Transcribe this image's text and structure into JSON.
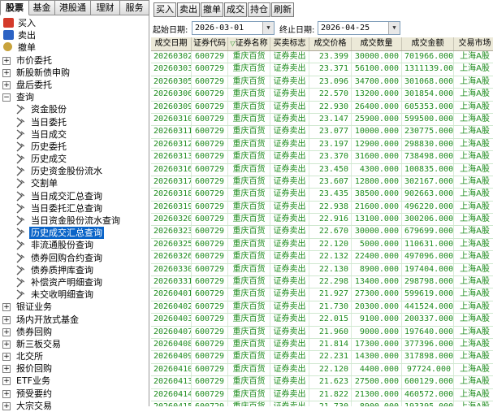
{
  "tabs": [
    "股票",
    "基金",
    "港股通",
    "理财",
    "服务"
  ],
  "active_tab": 0,
  "tree": [
    {
      "label": "买入",
      "icon": "buy-icon"
    },
    {
      "label": "卖出",
      "icon": "sell-icon"
    },
    {
      "label": "撤单",
      "icon": "stop-icon"
    },
    {
      "label": "市价委托",
      "expander": "+"
    },
    {
      "label": "新股新债申购",
      "expander": "+"
    },
    {
      "label": "盘后委托",
      "expander": "+"
    },
    {
      "label": "查询",
      "expander": "-"
    },
    {
      "label": "资金股份",
      "leaf": true
    },
    {
      "label": "当日委托",
      "leaf": true
    },
    {
      "label": "当日成交",
      "leaf": true
    },
    {
      "label": "历史委托",
      "leaf": true
    },
    {
      "label": "历史成交",
      "leaf": true
    },
    {
      "label": "历史资金股份流水",
      "leaf": true
    },
    {
      "label": "交割单",
      "leaf": true
    },
    {
      "label": "当日成交汇总查询",
      "leaf": true
    },
    {
      "label": "当日委托汇总查询",
      "leaf": true
    },
    {
      "label": "当日资金股份流水查询",
      "leaf": true
    },
    {
      "label": "历史成交汇总查询",
      "leaf": true,
      "selected": true
    },
    {
      "label": "非流通股份查询",
      "leaf": true
    },
    {
      "label": "债券回购合约查询",
      "leaf": true
    },
    {
      "label": "债券质押库查询",
      "leaf": true
    },
    {
      "label": "补偿资产明细查询",
      "leaf": true
    },
    {
      "label": "未交收明细查询",
      "leaf": true
    },
    {
      "label": "银证业务",
      "expander": "+"
    },
    {
      "label": "场内开放式基金",
      "expander": "+"
    },
    {
      "label": "债券回购",
      "expander": "+"
    },
    {
      "label": "新三板交易",
      "expander": "+"
    },
    {
      "label": "北交所",
      "expander": "+"
    },
    {
      "label": "报价回购",
      "expander": "+"
    },
    {
      "label": "ETF业务",
      "expander": "+"
    },
    {
      "label": "预受要约",
      "expander": "+"
    },
    {
      "label": "大宗交易",
      "expander": "+"
    }
  ],
  "toolbar": [
    "买入",
    "卖出",
    "撤单",
    "成交",
    "持仓",
    "刷新"
  ],
  "filters": {
    "start_label": "起始日期:",
    "start_value": "2026-03-01",
    "end_label": "终止日期:",
    "end_value": "2026-04-25"
  },
  "columns": [
    "成交日期",
    "证券代码",
    "证券名称",
    "买卖标志",
    "成交价格",
    "成交数量",
    "成交金额",
    "交易市场"
  ],
  "sort_column": 2,
  "rows": [
    [
      "20260302",
      "600729",
      "重庆百货",
      "证券卖出",
      "23.399",
      "30000.000",
      "701966.000",
      "上海A股"
    ],
    [
      "20260303",
      "600729",
      "重庆百货",
      "证券卖出",
      "23.371",
      "56100.000",
      "1311139.000",
      "上海A股"
    ],
    [
      "20260305",
      "600729",
      "重庆百货",
      "证券卖出",
      "23.096",
      "34700.000",
      "301068.000",
      "上海A股"
    ],
    [
      "20260306",
      "600729",
      "重庆百货",
      "证券卖出",
      "22.570",
      "13200.000",
      "301854.000",
      "上海A股"
    ],
    [
      "20260309",
      "600729",
      "重庆百货",
      "证券卖出",
      "22.930",
      "26400.000",
      "605353.000",
      "上海A股"
    ],
    [
      "20260310",
      "600729",
      "重庆百货",
      "证券卖出",
      "23.147",
      "25900.000",
      "599500.000",
      "上海A股"
    ],
    [
      "20260311",
      "600729",
      "重庆百货",
      "证券卖出",
      "23.077",
      "10000.000",
      "230775.000",
      "上海A股"
    ],
    [
      "20260312",
      "600729",
      "重庆百货",
      "证券卖出",
      "23.197",
      "12900.000",
      "298830.000",
      "上海A股"
    ],
    [
      "20260313",
      "600729",
      "重庆百货",
      "证券卖出",
      "23.370",
      "31600.000",
      "738498.000",
      "上海A股"
    ],
    [
      "20260316",
      "600729",
      "重庆百货",
      "证券卖出",
      "23.450",
      "4300.000",
      "100835.000",
      "上海A股"
    ],
    [
      "20260317",
      "600729",
      "重庆百货",
      "证券卖出",
      "23.607",
      "12800.000",
      "302167.000",
      "上海A股"
    ],
    [
      "20260318",
      "600729",
      "重庆百货",
      "证券卖出",
      "23.435",
      "38500.000",
      "902663.000",
      "上海A股"
    ],
    [
      "20260319",
      "600729",
      "重庆百货",
      "证券卖出",
      "22.938",
      "21600.000",
      "496220.000",
      "上海A股"
    ],
    [
      "20260320",
      "600729",
      "重庆百货",
      "证券卖出",
      "22.916",
      "13100.000",
      "300206.000",
      "上海A股"
    ],
    [
      "20260323",
      "600729",
      "重庆百货",
      "证券卖出",
      "22.670",
      "30000.000",
      "679699.000",
      "上海A股"
    ],
    [
      "20260325",
      "600729",
      "重庆百货",
      "证券卖出",
      "22.120",
      "5000.000",
      "110631.000",
      "上海A股"
    ],
    [
      "20260326",
      "600729",
      "重庆百货",
      "证券卖出",
      "22.132",
      "22400.000",
      "497096.000",
      "上海A股"
    ],
    [
      "20260330",
      "600729",
      "重庆百货",
      "证券卖出",
      "22.130",
      "8900.000",
      "197404.000",
      "上海A股"
    ],
    [
      "20260331",
      "600729",
      "重庆百货",
      "证券卖出",
      "22.298",
      "13400.000",
      "298798.000",
      "上海A股"
    ],
    [
      "20260401",
      "600729",
      "重庆百货",
      "证券卖出",
      "21.927",
      "27300.000",
      "599619.000",
      "上海A股"
    ],
    [
      "20260402",
      "600729",
      "重庆百货",
      "证券卖出",
      "21.730",
      "20300.000",
      "441524.000",
      "上海A股"
    ],
    [
      "20260403",
      "600729",
      "重庆百货",
      "证券卖出",
      "22.015",
      "9100.000",
      "200337.000",
      "上海A股"
    ],
    [
      "20260407",
      "600729",
      "重庆百货",
      "证券卖出",
      "21.960",
      "9000.000",
      "197640.000",
      "上海A股"
    ],
    [
      "20260408",
      "600729",
      "重庆百货",
      "证券卖出",
      "21.814",
      "17300.000",
      "377396.000",
      "上海A股"
    ],
    [
      "20260409",
      "600729",
      "重庆百货",
      "证券卖出",
      "22.231",
      "14300.000",
      "317898.000",
      "上海A股"
    ],
    [
      "20260410",
      "600729",
      "重庆百货",
      "证券卖出",
      "22.120",
      "4400.000",
      "97724.000",
      "上海A股"
    ],
    [
      "20260413",
      "600729",
      "重庆百货",
      "证券卖出",
      "21.623",
      "27500.000",
      "600129.000",
      "上海A股"
    ],
    [
      "20260414",
      "600729",
      "重庆百货",
      "证券卖出",
      "21.822",
      "21300.000",
      "460572.000",
      "上海A股"
    ],
    [
      "20260415",
      "600729",
      "重庆百货",
      "证券卖出",
      "21.730",
      "8900.000",
      "193395.000",
      "上海A股"
    ],
    [
      "20260416",
      "600729",
      "重庆百货",
      "证券卖出",
      "21.709",
      "8900.000",
      "193213.000",
      "上海A股"
    ]
  ],
  "chart_data": {
    "type": "table",
    "title": "",
    "columns": [
      "成交日期",
      "证券代码",
      "证券名称",
      "买卖标志",
      "成交价格",
      "成交数量",
      "成交金额",
      "交易市场"
    ],
    "rows": [
      [
        "20260302",
        "600729",
        "重庆百货",
        "证券卖出",
        23.399,
        30000,
        701966,
        "上海A股"
      ],
      [
        "20260303",
        "600729",
        "重庆百货",
        "证券卖出",
        23.371,
        56100,
        1311139,
        "上海A股"
      ],
      [
        "20260305",
        "600729",
        "重庆百货",
        "证券卖出",
        23.096,
        34700,
        301068,
        "上海A股"
      ],
      [
        "20260306",
        "600729",
        "重庆百货",
        "证券卖出",
        22.57,
        13200,
        301854,
        "上海A股"
      ],
      [
        "20260309",
        "600729",
        "重庆百货",
        "证券卖出",
        22.93,
        26400,
        605353,
        "上海A股"
      ],
      [
        "20260310",
        "600729",
        "重庆百货",
        "证券卖出",
        23.147,
        25900,
        599500,
        "上海A股"
      ],
      [
        "20260311",
        "600729",
        "重庆百货",
        "证券卖出",
        23.077,
        10000,
        230775,
        "上海A股"
      ],
      [
        "20260312",
        "600729",
        "重庆百货",
        "证券卖出",
        23.197,
        12900,
        298830,
        "上海A股"
      ],
      [
        "20260313",
        "600729",
        "重庆百货",
        "证券卖出",
        23.37,
        31600,
        738498,
        "上海A股"
      ],
      [
        "20260316",
        "600729",
        "重庆百货",
        "证券卖出",
        23.45,
        4300,
        100835,
        "上海A股"
      ],
      [
        "20260317",
        "600729",
        "重庆百货",
        "证券卖出",
        23.607,
        12800,
        302167,
        "上海A股"
      ],
      [
        "20260318",
        "600729",
        "重庆百货",
        "证券卖出",
        23.435,
        38500,
        902663,
        "上海A股"
      ],
      [
        "20260319",
        "600729",
        "重庆百货",
        "证券卖出",
        22.938,
        21600,
        496220,
        "上海A股"
      ],
      [
        "20260320",
        "600729",
        "重庆百货",
        "证券卖出",
        22.916,
        13100,
        300206,
        "上海A股"
      ],
      [
        "20260323",
        "600729",
        "重庆百货",
        "证券卖出",
        22.67,
        30000,
        679699,
        "上海A股"
      ],
      [
        "20260325",
        "600729",
        "重庆百货",
        "证券卖出",
        22.12,
        5000,
        110631,
        "上海A股"
      ],
      [
        "20260326",
        "600729",
        "重庆百货",
        "证券卖出",
        22.132,
        22400,
        497096,
        "上海A股"
      ],
      [
        "20260330",
        "600729",
        "重庆百货",
        "证券卖出",
        22.13,
        8900,
        197404,
        "上海A股"
      ],
      [
        "20260331",
        "600729",
        "重庆百货",
        "证券卖出",
        22.298,
        13400,
        298798,
        "上海A股"
      ],
      [
        "20260401",
        "600729",
        "重庆百货",
        "证券卖出",
        21.927,
        27300,
        599619,
        "上海A股"
      ],
      [
        "20260402",
        "600729",
        "重庆百货",
        "证券卖出",
        21.73,
        20300,
        441524,
        "上海A股"
      ],
      [
        "20260403",
        "600729",
        "重庆百货",
        "证券卖出",
        22.015,
        9100,
        200337,
        "上海A股"
      ],
      [
        "20260407",
        "600729",
        "重庆百货",
        "证券卖出",
        21.96,
        9000,
        197640,
        "上海A股"
      ],
      [
        "20260408",
        "600729",
        "重庆百货",
        "证券卖出",
        21.814,
        17300,
        377396,
        "上海A股"
      ],
      [
        "20260409",
        "600729",
        "重庆百货",
        "证券卖出",
        22.231,
        14300,
        317898,
        "上海A股"
      ],
      [
        "20260410",
        "600729",
        "重庆百货",
        "证券卖出",
        22.12,
        4400,
        97724,
        "上海A股"
      ],
      [
        "20260413",
        "600729",
        "重庆百货",
        "证券卖出",
        21.623,
        27500,
        600129,
        "上海A股"
      ],
      [
        "20260414",
        "600729",
        "重庆百货",
        "证券卖出",
        21.822,
        21300,
        460572,
        "上海A股"
      ],
      [
        "20260415",
        "600729",
        "重庆百货",
        "证券卖出",
        21.73,
        8900,
        193395,
        "上海A股"
      ],
      [
        "20260416",
        "600729",
        "重庆百货",
        "证券卖出",
        21.709,
        8900,
        193213,
        "上海A股"
      ]
    ]
  },
  "colors": {
    "row_text": "#1e8c1e",
    "selected_bg": "#0a64c8",
    "header_bg": "#ece9d8"
  }
}
